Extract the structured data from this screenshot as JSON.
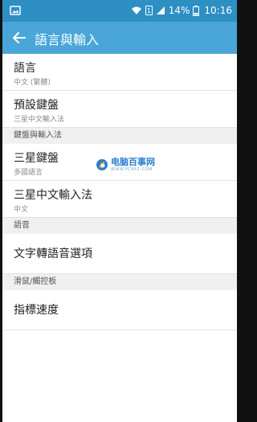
{
  "statusbar": {
    "battery_text": "14%",
    "time": "10:16",
    "sim_badge": "1",
    "icons": [
      "gallery-icon",
      "wifi-icon",
      "sim-icon",
      "signal-icon",
      "battery-icon"
    ]
  },
  "appbar": {
    "title": "語言與輸入"
  },
  "items": {
    "language": {
      "title": "語言",
      "subtitle": "中文 (繁體)"
    },
    "default_keyboard": {
      "title": "預設鍵盤",
      "subtitle": "三星中文輸入法"
    }
  },
  "sections": {
    "keyboard_input": "鍵盤與輸入法",
    "speech": "語音",
    "mouse_trackpad": "滑鼠/觸控板"
  },
  "keyboard_items": {
    "samsung_keyboard": {
      "title": "三星鍵盤",
      "subtitle": "多國語言"
    },
    "samsung_chinese": {
      "title": "三星中文輸入法",
      "subtitle": "中文"
    }
  },
  "speech_items": {
    "tts": {
      "title": "文字轉語音選項"
    }
  },
  "mouse_items": {
    "pointer_speed": {
      "title": "指標速度"
    }
  },
  "watermark": {
    "text": "电脑百事网",
    "url": "WWW.PC841.COM"
  },
  "colors": {
    "statusbar": "#2d8fc4",
    "appbar": "#4aa6d8",
    "section_bg": "#f0f0f0"
  }
}
